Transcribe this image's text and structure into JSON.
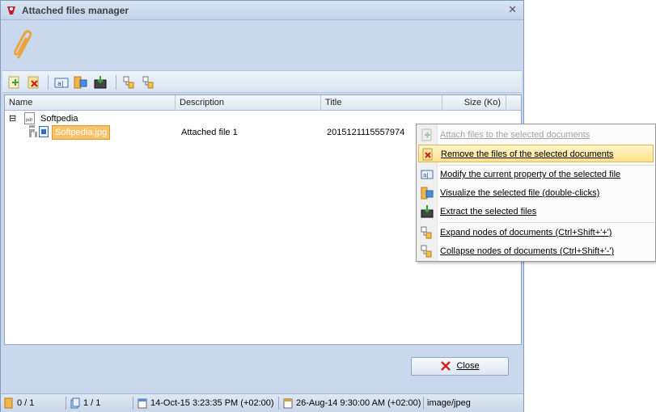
{
  "window": {
    "title": "Attached files manager",
    "close_glyph": "✕"
  },
  "toolbar": {
    "buttons": [
      {
        "name": "attach-files-icon"
      },
      {
        "name": "remove-files-icon"
      },
      {
        "name": "modify-property-icon"
      },
      {
        "name": "visualize-file-icon"
      },
      {
        "name": "extract-files-icon"
      },
      {
        "name": "expand-nodes-icon"
      },
      {
        "name": "collapse-nodes-icon"
      }
    ]
  },
  "grid": {
    "columns": [
      "Name",
      "Description",
      "Title",
      "Size (Ko)"
    ],
    "root": {
      "expander": "⊟",
      "label": "Softpedia"
    },
    "child": {
      "label": "Softpedia.jpg",
      "description": "Attached file 1",
      "title": "2015121115557974"
    }
  },
  "close_button": {
    "label": "Close"
  },
  "statusbar": {
    "selected_count": "0 / 1",
    "docs_count": "1 / 1",
    "modified": "14-Oct-15 3:23:35 PM (+02:00)",
    "created": "26-Aug-14 9:30:00 AM (+02:00)",
    "mime": "image/jpeg"
  },
  "context_menu": {
    "items": [
      {
        "label": "Attach files to the selected documents",
        "enabled": false
      },
      {
        "label": "Remove the files of the selected documents",
        "enabled": true
      },
      {
        "label": "Modify the current property of the selected file",
        "enabled": true
      },
      {
        "label": "Visualize the selected file (double-clicks)",
        "enabled": true
      },
      {
        "label": "Extract the selected files",
        "enabled": true
      },
      {
        "label": "Expand nodes of documents (Ctrl+Shift+'+')",
        "enabled": true
      },
      {
        "label": "Collapse nodes of documents (Ctrl+Shift+'-')",
        "enabled": true
      }
    ]
  },
  "colors": {
    "selection": "#f7c26a",
    "window_bg": "#c9d8ec",
    "menu_highlight": "#ffe28a"
  }
}
